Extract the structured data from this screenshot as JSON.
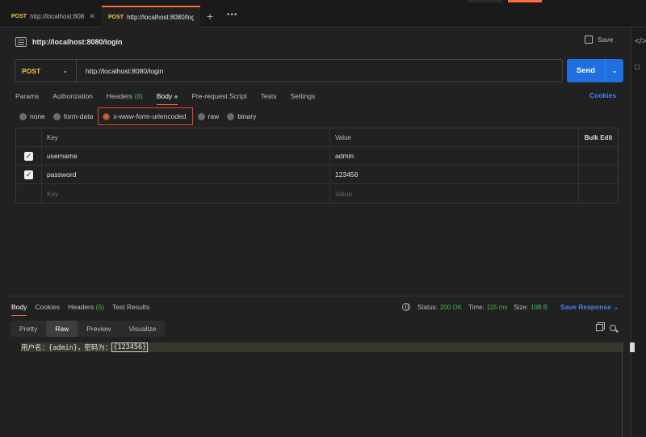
{
  "tabs": [
    {
      "method": "POST",
      "label": "http://localhost:8080",
      "close": "✕"
    },
    {
      "method": "POST",
      "label": "http://localhost:8080/log",
      "close": "✕"
    }
  ],
  "tab_plus": "+",
  "tab_more": "•••",
  "request": {
    "title": "http://localhost:8080/login",
    "save_label": "Save",
    "method": "POST",
    "url": "http://localhost:8080/login",
    "send_label": "Send"
  },
  "req_tabs": {
    "params": "Params",
    "authorization": "Authorization",
    "headers": "Headers",
    "headers_count": "(8)",
    "body": "Body",
    "pre_request": "Pre-request Script",
    "tests": "Tests",
    "settings": "Settings",
    "cookies": "Cookies"
  },
  "body_types": {
    "none": "none",
    "form_data": "form-data",
    "urlencoded": "x-www-form-urlencoded",
    "raw": "raw",
    "binary": "binary"
  },
  "kv_table": {
    "header_key": "Key",
    "header_value": "Value",
    "bulk_edit": "Bulk Edit",
    "rows": [
      {
        "key": "username",
        "value": "admin"
      },
      {
        "key": "password",
        "value": "123456"
      }
    ],
    "placeholder_key": "Key",
    "placeholder_value": "Value"
  },
  "response": {
    "tab_body": "Body",
    "tab_cookies": "Cookies",
    "tab_headers": "Headers",
    "headers_count": "(5)",
    "tab_tests": "Test Results",
    "status_label": "Status:",
    "status_value": "200 OK",
    "time_label": "Time:",
    "time_value": "115 ms",
    "size_label": "Size:",
    "size_value": "198 B",
    "save_response": "Save Response",
    "views": {
      "pretty": "Pretty",
      "raw": "Raw",
      "preview": "Preview",
      "visualize": "Visualize"
    },
    "body_text": "用户名：{admin}，密码为：",
    "body_highlight": "{123456}"
  },
  "colors": {
    "accent": "#ff6c37",
    "send": "#1f6fe0",
    "method": "#f5c542",
    "success": "#3fb950",
    "link": "#3f86f0"
  }
}
